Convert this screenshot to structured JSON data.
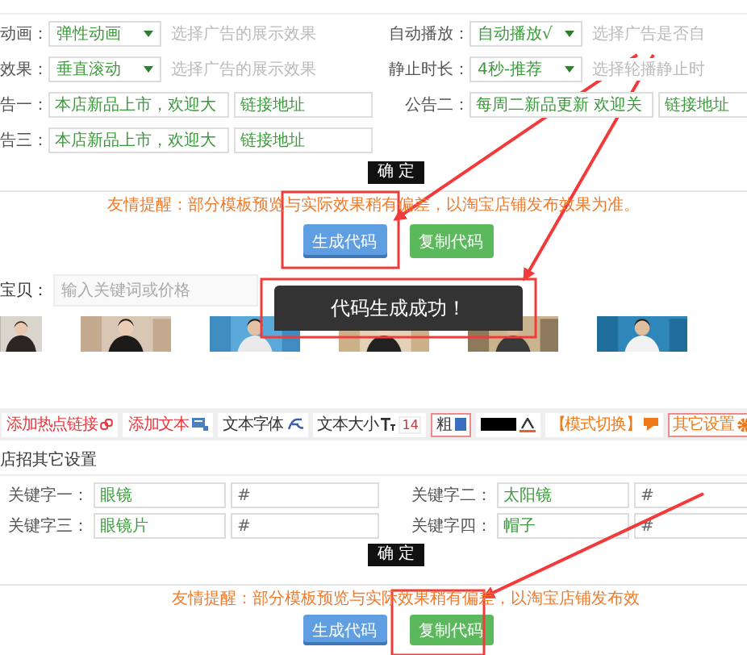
{
  "ad_form": {
    "left": [
      {
        "label": "动画：",
        "kind": "select",
        "value": "弹性动画",
        "hint": "选择广告的展示效果"
      },
      {
        "label": "效果：",
        "kind": "select",
        "value": "垂直滚动",
        "hint": "选择广告的展示效果"
      },
      {
        "label": "告一：",
        "kind": "text",
        "value": "本店新品上市，欢迎大",
        "link": "链接地址"
      },
      {
        "label": "告三：",
        "kind": "text",
        "value": "本店新品上市，欢迎大",
        "link": "链接地址"
      }
    ],
    "right": [
      {
        "label": "自动播放：",
        "kind": "select",
        "value": "自动播放√",
        "hint": "选择广告是否自"
      },
      {
        "label": "静止时长：",
        "kind": "select",
        "value": "4秒-推荐",
        "hint": "选择轮播静止时"
      },
      {
        "label": "公告二：",
        "kind": "text",
        "value": "每周二新品更新 欢迎关",
        "link": "链接地址"
      }
    ],
    "confirm": "确 定"
  },
  "notice": "友情提醒：部分模板预览与实际效果稍有偏差，以淘宝店铺发布效果为准。",
  "buttons": [
    {
      "label": "生成代码",
      "kind": "primary"
    },
    {
      "label": "复制代码",
      "kind": "success"
    }
  ],
  "search": {
    "label": "宝贝：",
    "placeholder": "输入关键词或价格"
  },
  "toast": "代码生成成功！",
  "toolbar": [
    {
      "kind": "hotlink",
      "label": "添加热点链接"
    },
    {
      "kind": "text",
      "label": "添加文本"
    },
    {
      "kind": "font",
      "label": "文本字体"
    },
    {
      "kind": "size",
      "label": "文本大小",
      "value": "14"
    },
    {
      "kind": "bold",
      "label": "粗"
    },
    {
      "kind": "color",
      "color": "#000000"
    },
    {
      "kind": "mode",
      "label": "【模式切换】"
    },
    {
      "kind": "settings",
      "label": "其它设置"
    }
  ],
  "other_settings": {
    "title": "店招其它设置",
    "keywords": [
      {
        "label": "关键字一：",
        "value": "眼镜",
        "link": "#"
      },
      {
        "label": "关键字二：",
        "value": "太阳镜",
        "link": "#"
      },
      {
        "label": "关键字三：",
        "value": "眼镜片",
        "link": "#"
      },
      {
        "label": "关键字四：",
        "value": "帽子",
        "link": "#"
      }
    ],
    "confirm": "确 定"
  },
  "notice_2": "友情提醒：部分模板预览与实际效果稍有偏差，以淘宝店铺发布效",
  "buttons_2": [
    {
      "label": "生成代码",
      "kind": "primary"
    },
    {
      "label": "复制代码",
      "kind": "success"
    }
  ]
}
